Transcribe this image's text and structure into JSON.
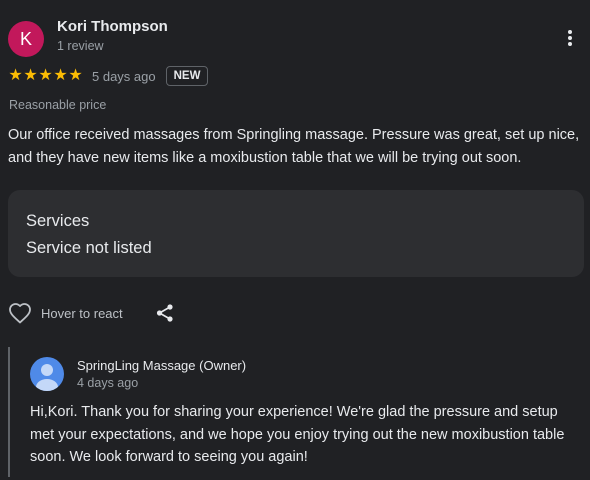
{
  "reviewer": {
    "initial": "K",
    "avatar_color": "#c2185b",
    "name": "Kori Thompson",
    "meta": "1 review"
  },
  "rating": {
    "stars": 5,
    "stars_text": "★★★★★",
    "date": "5 days ago",
    "badge": "NEW"
  },
  "tag": "Reasonable price",
  "review_text": "Our office received massages from Springling massage. Pressure was great, set up nice, and they have new items like a moxibustion table that we will be trying out soon.",
  "services": {
    "title": "Services",
    "value": "Service not listed"
  },
  "actions": {
    "react_label": "Hover to react"
  },
  "owner_reply": {
    "name": "SpringLing Massage (Owner)",
    "date": "4 days ago",
    "text": "Hi,Kori. Thank you for sharing your experience! We're glad the pressure and setup met your expectations, and we hope you enjoy trying out the new moxibustion table soon. We look forward to seeing you again!"
  },
  "colors": {
    "background": "#202124",
    "star": "#fbbc04",
    "services_bg": "#2d2e31",
    "owner_avatar": "#4f8ae8"
  },
  "icons": [
    "more-vert-icon",
    "star-icon",
    "heart-icon",
    "share-icon",
    "person-icon"
  ]
}
